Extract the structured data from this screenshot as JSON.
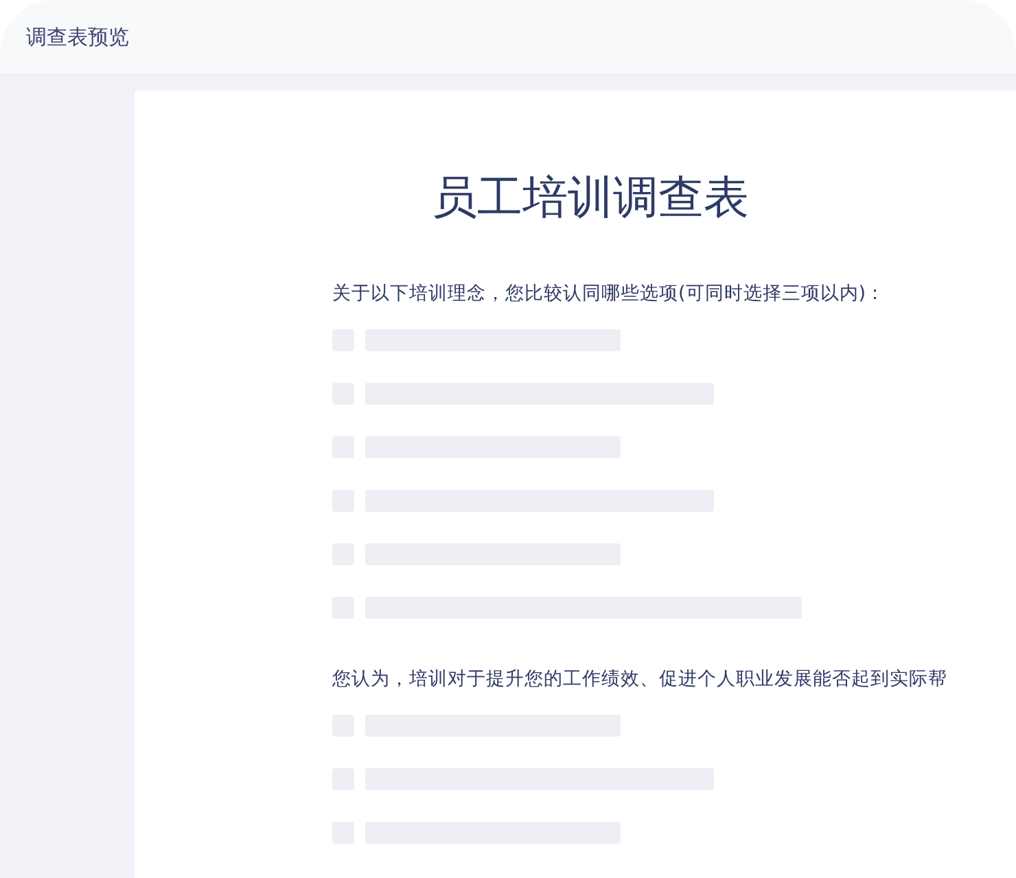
{
  "window": {
    "title": "调查表预览"
  },
  "document": {
    "title": "员工培训调查表",
    "questions": [
      {
        "text": "关于以下培训理念，您比较认同哪些选项(可同时选择三项以内)：",
        "options": [
          {
            "kind": "short"
          },
          {
            "kind": "medium"
          },
          {
            "kind": "short"
          },
          {
            "kind": "medium"
          },
          {
            "kind": "short"
          },
          {
            "kind": "long"
          }
        ]
      },
      {
        "text": "您认为，培训对于提升您的工作绩效、促进个人职业发展能否起到实际帮",
        "options": [
          {
            "kind": "short"
          },
          {
            "kind": "medium"
          },
          {
            "kind": "short"
          }
        ]
      }
    ]
  }
}
